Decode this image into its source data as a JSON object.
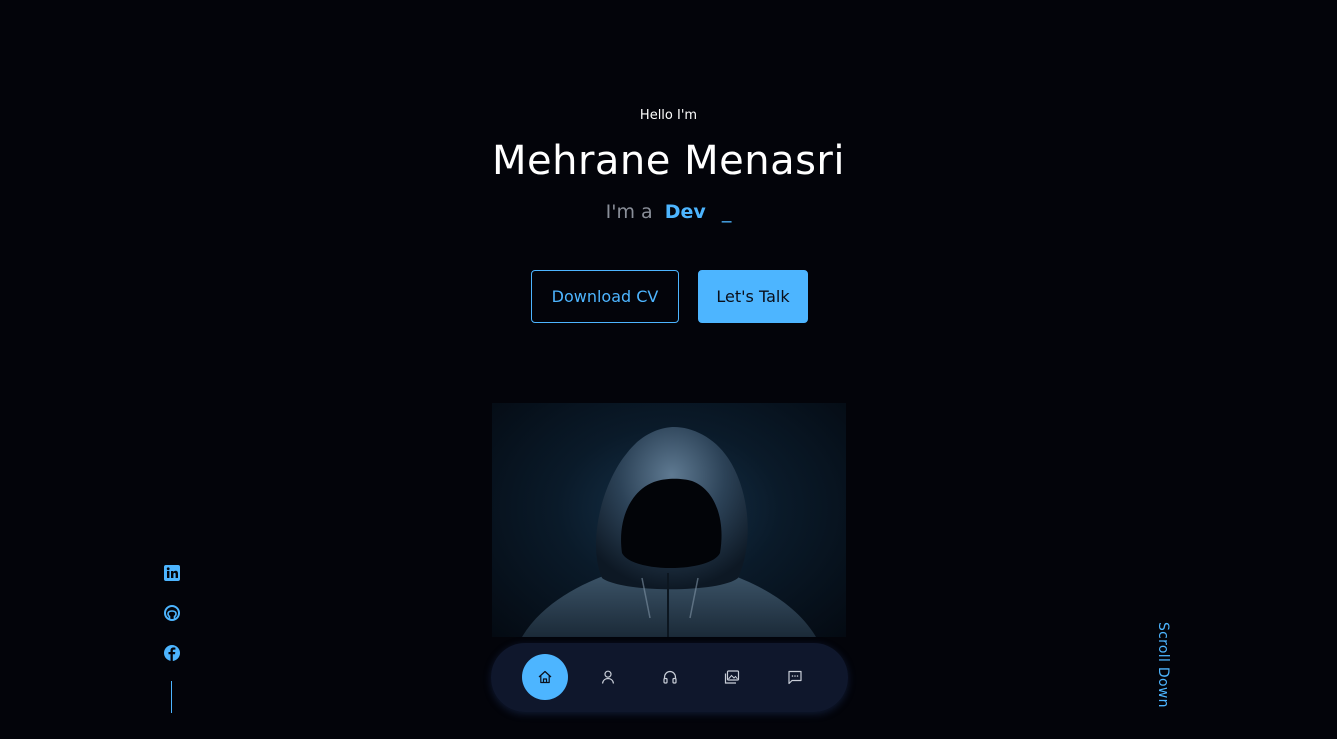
{
  "hero": {
    "greeting": "Hello I'm",
    "name": "Mehrane Menasri",
    "role_prefix": "I'm a",
    "role_word": "Dev",
    "cursor": "_"
  },
  "cta": {
    "download_label": "Download CV",
    "talk_label": "Let's Talk"
  },
  "portrait": {
    "icon": "hooded-figure-image"
  },
  "socials": [
    {
      "name": "linkedin-icon"
    },
    {
      "name": "github-icon"
    },
    {
      "name": "facebook-icon"
    }
  ],
  "nav": {
    "items": [
      {
        "icon": "home-icon",
        "active": true
      },
      {
        "icon": "user-icon",
        "active": false
      },
      {
        "icon": "headphones-icon",
        "active": false
      },
      {
        "icon": "gallery-icon",
        "active": false
      },
      {
        "icon": "message-icon",
        "active": false
      }
    ]
  },
  "scroll": {
    "label": "Scroll Down"
  },
  "colors": {
    "accent": "#4db5ff",
    "background": "#03040a",
    "nav_bg": "#141e38"
  }
}
